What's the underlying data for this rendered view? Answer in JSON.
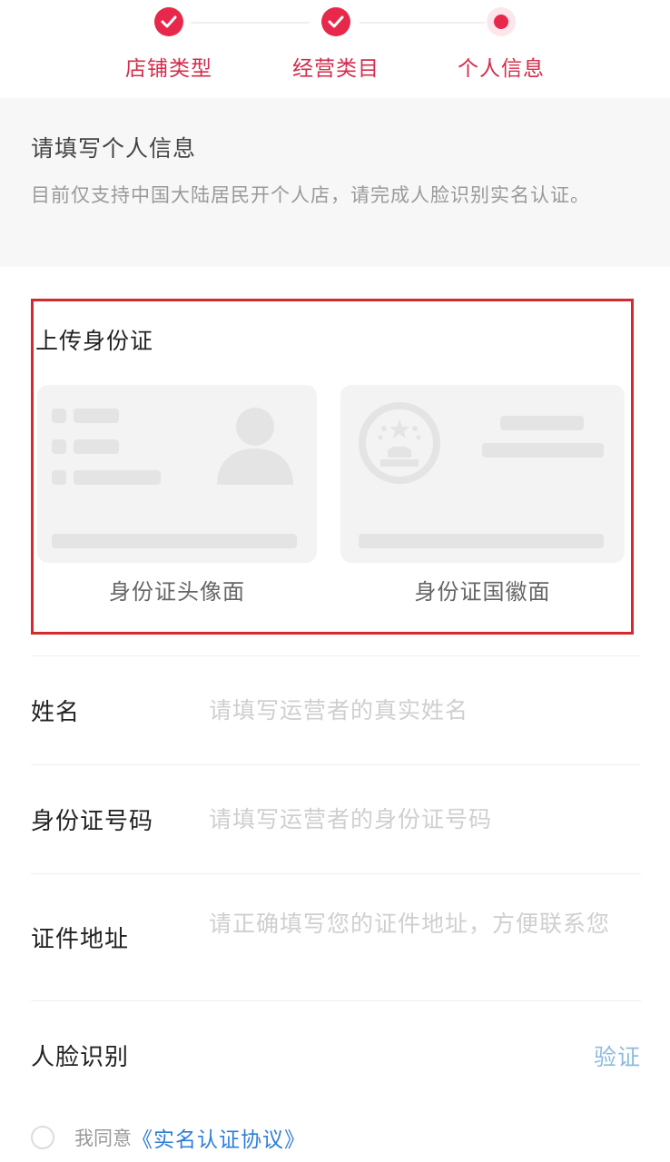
{
  "stepper": {
    "steps": [
      {
        "label": "店铺类型",
        "state": "done"
      },
      {
        "label": "经营类目",
        "state": "done"
      },
      {
        "label": "个人信息",
        "state": "current"
      }
    ],
    "accent_color": "#e8284a"
  },
  "intro": {
    "title": "请填写个人信息",
    "description": "目前仅支持中国大陆居民开个人店，请完成人脸识别实名认证。"
  },
  "upload": {
    "title": "上传身份证",
    "front_caption": "身份证头像面",
    "back_caption": "身份证国徽面",
    "highlight_color": "#d6282f"
  },
  "form": {
    "name": {
      "label": "姓名",
      "placeholder": "请填写运营者的真实姓名"
    },
    "id_number": {
      "label": "身份证号码",
      "placeholder": "请填写运营者的身份证号码"
    },
    "address": {
      "label": "证件地址",
      "placeholder": "请正确填写您的证件地址，方便联系您"
    },
    "face": {
      "label": "人脸识别",
      "action": "验证"
    }
  },
  "agreement": {
    "prefix": "我同意",
    "link": "《实名认证协议》"
  }
}
